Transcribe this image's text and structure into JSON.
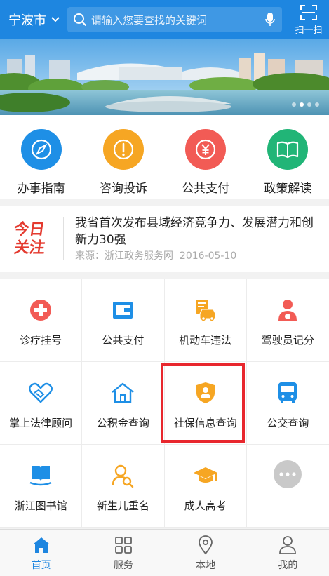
{
  "header": {
    "city": "宁波市",
    "search_placeholder": "请输入您要查找的关键词",
    "scan_label": "扫一扫"
  },
  "banner": {
    "slide_count": 4,
    "active_slide": 1
  },
  "quick_services": [
    {
      "label": "办事指南",
      "icon": "compass-icon",
      "color": "#1e8fe6"
    },
    {
      "label": "咨询投诉",
      "icon": "exclamation-icon",
      "color": "#f6a623"
    },
    {
      "label": "公共支付",
      "icon": "yuan-icon",
      "color": "#f25b55"
    },
    {
      "label": "政策解读",
      "icon": "book-icon",
      "color": "#21b577"
    }
  ],
  "news": {
    "logo_text": "今日关注",
    "headline": "我省首次发布县域经济竞争力、发展潜力和创新力30强",
    "source": "来源：浙江政务服务网",
    "date": "2016-05-10"
  },
  "services": [
    {
      "label": "诊疗挂号",
      "icon": "medical-cross-icon"
    },
    {
      "label": "公共支付",
      "icon": "wallet-icon"
    },
    {
      "label": "机动车违法",
      "icon": "car-ticket-icon"
    },
    {
      "label": "驾驶员记分",
      "icon": "driver-icon"
    },
    {
      "label": "掌上法律顾问",
      "icon": "handshake-icon"
    },
    {
      "label": "公积金查询",
      "icon": "house-icon"
    },
    {
      "label": "社保信息查询",
      "icon": "shield-person-icon",
      "highlighted": true
    },
    {
      "label": "公交查询",
      "icon": "bus-icon"
    },
    {
      "label": "浙江图书馆",
      "icon": "library-book-icon"
    },
    {
      "label": "新生儿重名",
      "icon": "baby-search-icon"
    },
    {
      "label": "成人高考",
      "icon": "graduation-cap-icon"
    },
    {
      "label": "",
      "icon": "more-icon"
    }
  ],
  "tabbar": [
    {
      "label": "首页",
      "icon": "home-icon",
      "active": true
    },
    {
      "label": "服务",
      "icon": "grid-icon",
      "active": false
    },
    {
      "label": "本地",
      "icon": "location-pin-icon",
      "active": false
    },
    {
      "label": "我的",
      "icon": "user-icon",
      "active": false
    }
  ],
  "colors": {
    "brand_blue": "#1e86e0",
    "highlight_red": "#e8272d"
  }
}
